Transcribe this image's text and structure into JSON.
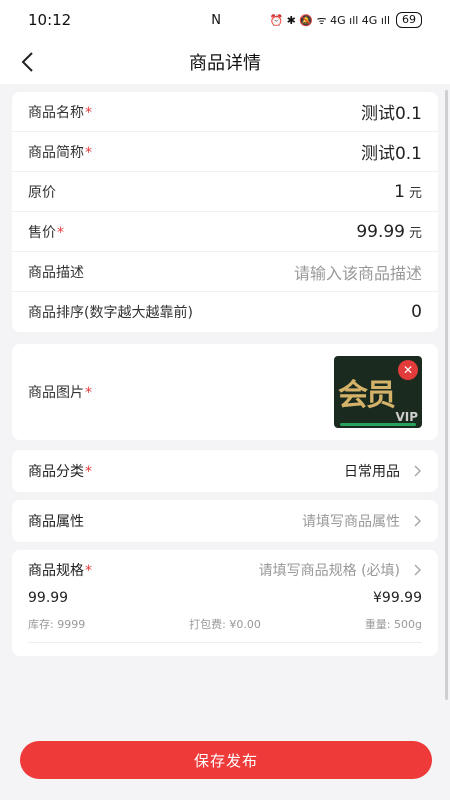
{
  "status": {
    "time": "10:12",
    "nfc": "N",
    "indicators": "⏰ ✱ 🔕 ᯤ 4G ıll 4G ıll",
    "battery": "69"
  },
  "nav": {
    "title": "商品详情"
  },
  "basic": {
    "name_label": "商品名称",
    "name_value": "测试0.1",
    "short_label": "商品简称",
    "short_value": "测试0.1",
    "orig_label": "原价",
    "orig_value": "1",
    "unit": "元",
    "sale_label": "售价",
    "sale_value": "99.99",
    "desc_label": "商品描述",
    "desc_placeholder": "请输入该商品描述",
    "sort_label": "商品排序(数字越大越靠前)",
    "sort_value": "0"
  },
  "image": {
    "label": "商品图片",
    "thumb_text": "会员",
    "thumb_vip": "VIP",
    "delete_icon": "✕"
  },
  "category": {
    "label": "商品分类",
    "value": "日常用品"
  },
  "attr": {
    "label": "商品属性",
    "placeholder": "请填写商品属性"
  },
  "spec": {
    "label": "商品规格",
    "placeholder": "请填写商品规格 (必填)",
    "name": "99.99",
    "price": "¥99.99",
    "stock": "库存: 9999",
    "pack_fee": "打包费: ¥0.00",
    "weight": "重量: 500g"
  },
  "required_mark": "*",
  "save_label": "保存发布",
  "colors": {
    "accent": "#ef3a3a",
    "required": "#e43a3a"
  }
}
